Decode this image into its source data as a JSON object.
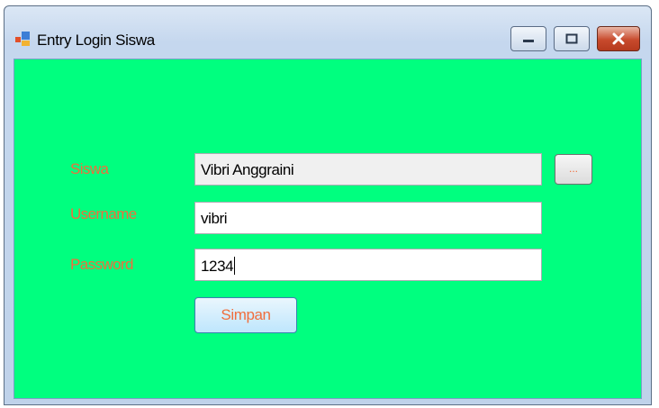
{
  "window": {
    "title": "Entry Login Siswa",
    "icon": "windows-form-icon"
  },
  "form": {
    "siswa_label": "Siswa",
    "siswa_value": "Vibri Anggraini",
    "browse_label": "...",
    "username_label": "Username",
    "username_value": "vibri",
    "password_label": "Password",
    "password_value": "1234",
    "save_label": "Simpan"
  },
  "colors": {
    "form_background": "#00ff7f",
    "label_text": "#f06e3c"
  }
}
